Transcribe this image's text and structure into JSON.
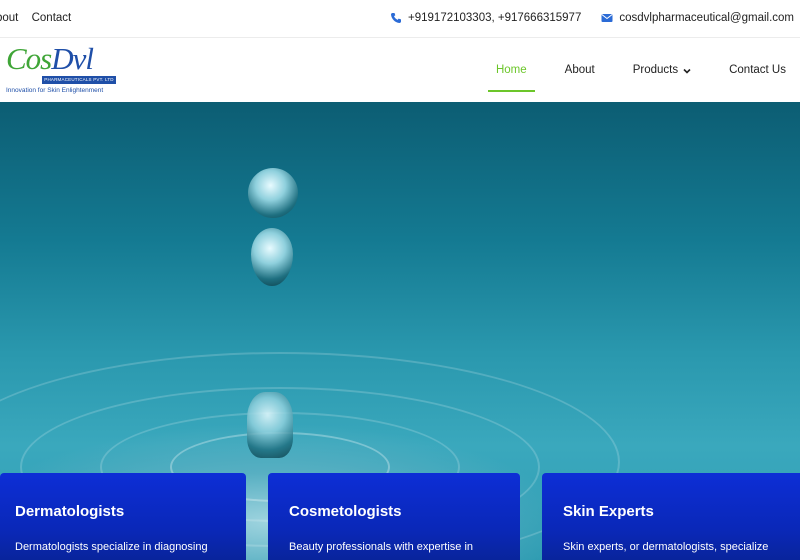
{
  "topbar": {
    "links": [
      "bout",
      "Contact"
    ],
    "phone": "+919172103303, +917666315977",
    "email": "cosdvlpharmaceutical@gmail.com",
    "icons": [
      "phone-icon",
      "envelope-icon"
    ],
    "accent": "#2b6bd6"
  },
  "logo": {
    "word_left": "Cos",
    "word_right": "Dvl",
    "band": "PHARMACEUTICALS PVT. LTD",
    "tagline": "Innovation for Skin Enlightenment"
  },
  "nav": {
    "items": [
      {
        "label": "Home",
        "active": true
      },
      {
        "label": "About",
        "active": false
      },
      {
        "label": "Products",
        "active": false,
        "dropdown": true
      },
      {
        "label": "Contact Us",
        "active": false
      }
    ],
    "active_color": "#6cc62a"
  },
  "cards": [
    {
      "title": "Dermatologists",
      "text": "Dermatologists specialize in diagnosing"
    },
    {
      "title": "Cosmetologists",
      "text": "Beauty professionals with expertise in"
    },
    {
      "title": "Skin Experts",
      "text": "Skin experts, or dermatologists, specialize"
    }
  ],
  "colors": {
    "card_blue": "#0a28b8",
    "water": "#2a98ae"
  }
}
